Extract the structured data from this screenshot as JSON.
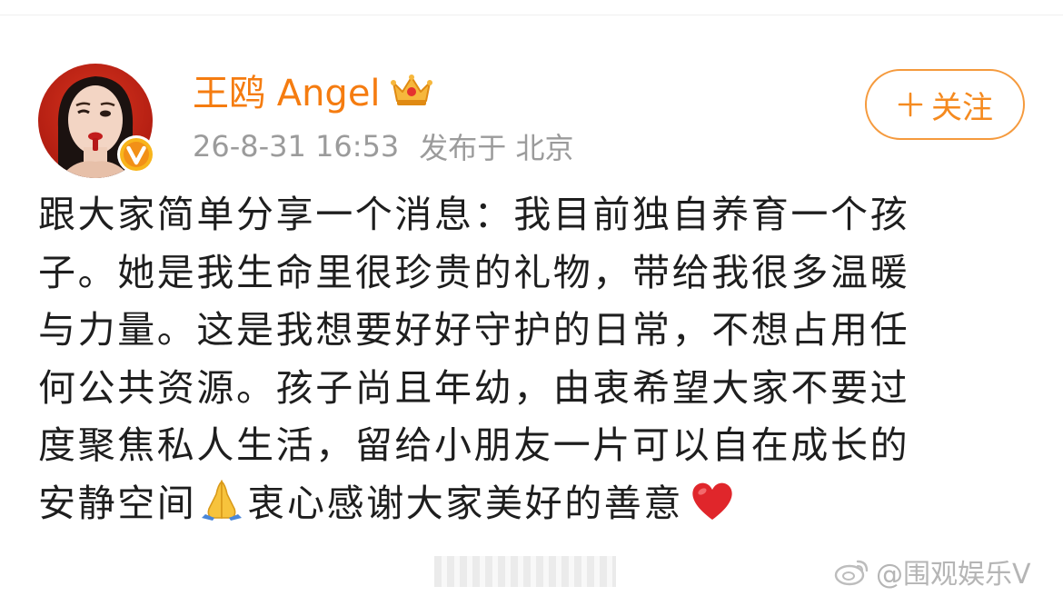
{
  "user": {
    "name": "王鸥 Angel",
    "timestamp": "26-8-31 16:53",
    "location_text": "发布于 北京"
  },
  "follow_button": {
    "label": "关注"
  },
  "post": {
    "lines": [
      "跟大家简单分享一个消息：我目前独自养育一个孩",
      "子。她是我生命里很珍贵的礼物，带给我很多温暖",
      "与力量。这是我想要好好守护的日常，不想占用任",
      "何公共资源。孩子尚且年幼，由衷希望大家不要过",
      "度聚焦私人生活，留给小朋友一片可以自在成长的"
    ],
    "last_line": {
      "before_emoji": "安静空间",
      "emoji_1": "folded-hands-icon",
      "after_emoji": "衷心感谢大家美好的善意",
      "emoji_2": "red-heart-icon"
    }
  },
  "watermark": {
    "text": "@围观娱乐V"
  },
  "colors": {
    "username": "#f57c10",
    "follow_accent": "#f58a1f",
    "meta_gray": "#9b9b9b",
    "body_text": "#1e1e1e",
    "badge_yellow": "#f8b51c",
    "badge_orange": "#f29017"
  }
}
